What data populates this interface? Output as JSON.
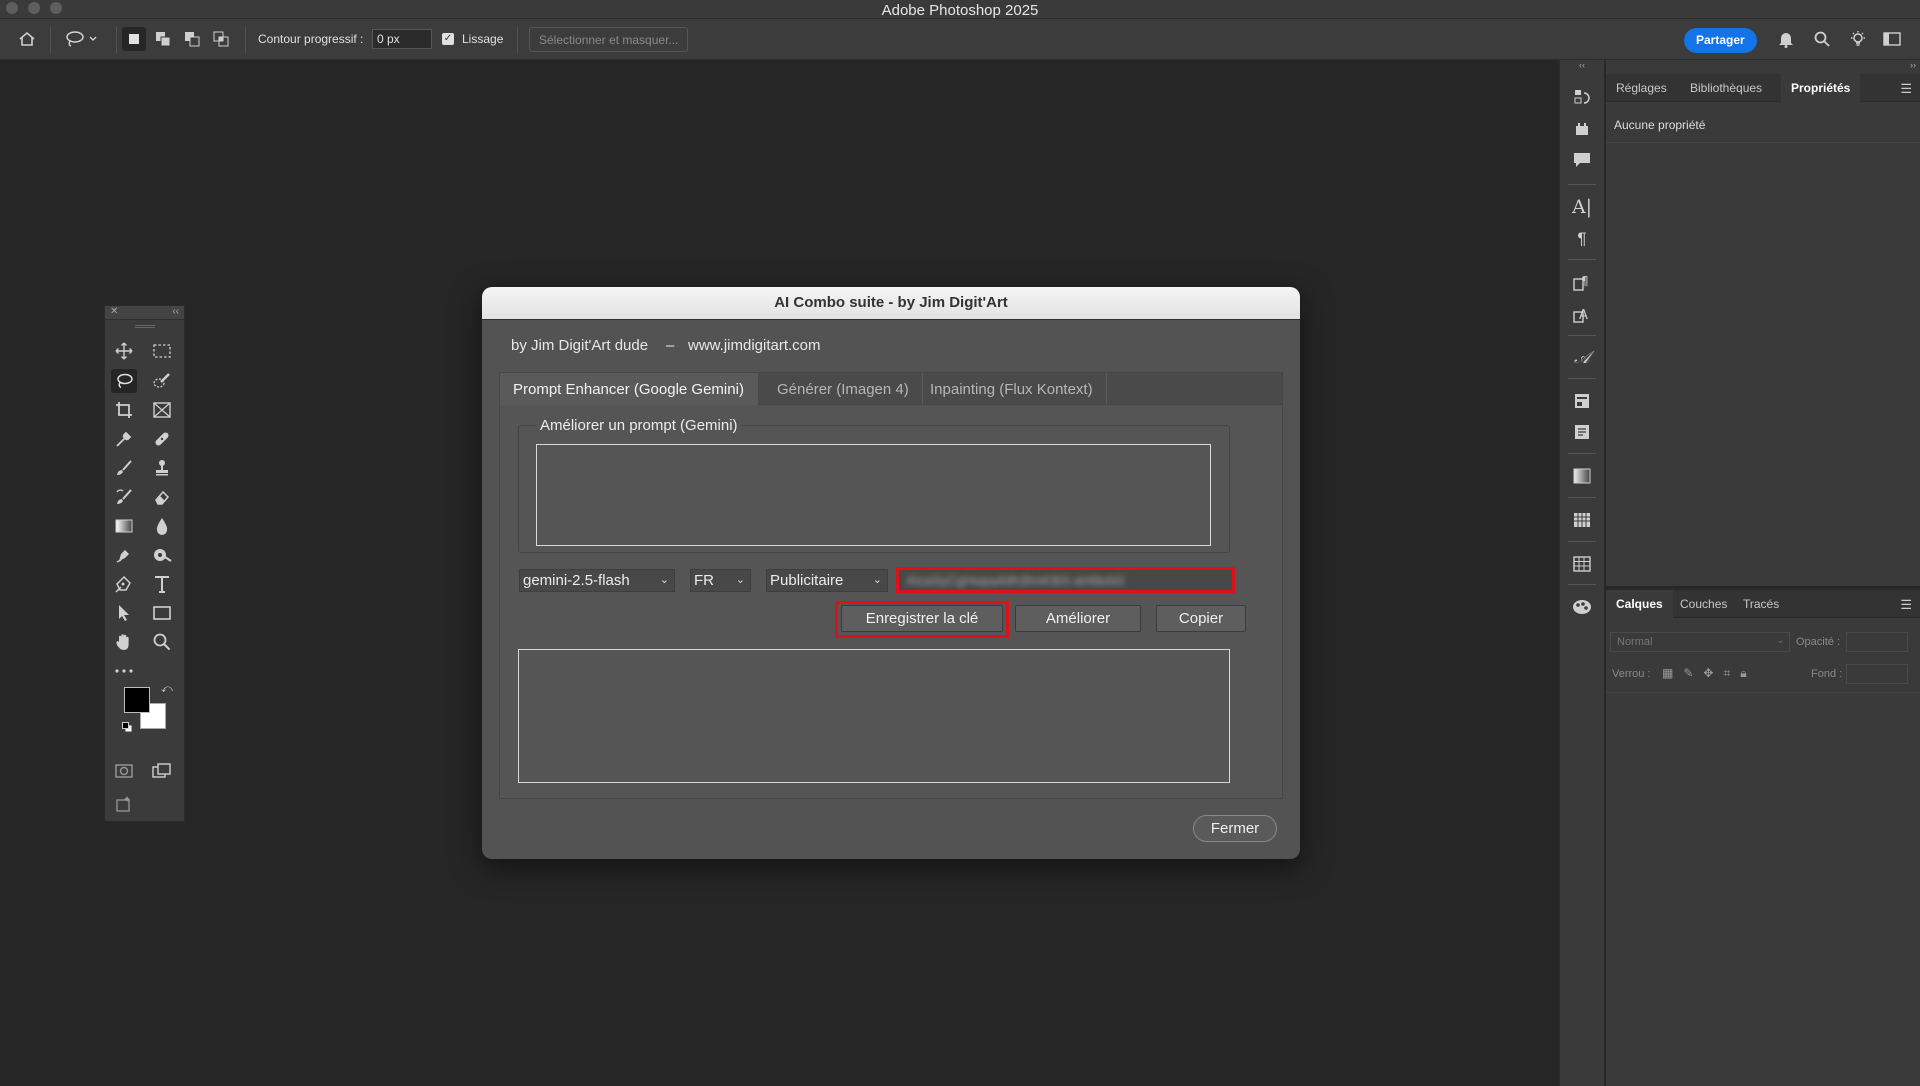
{
  "app": {
    "window_title": "Adobe Photoshop 2025"
  },
  "options_bar": {
    "feather_label": "Contour progressif :",
    "feather_value": "0 px",
    "antialias_label": "Lissage",
    "antialias_checked": true,
    "select_mask_label": "Sélectionner et masquer...",
    "share_label": "Partager"
  },
  "properties_panel": {
    "tabs": [
      "Réglages",
      "Bibliothèques",
      "Propriétés"
    ],
    "active_tab": "Propriétés",
    "empty_text": "Aucune propriété"
  },
  "layers_panel": {
    "tabs": [
      "Calques",
      "Couches",
      "Tracés"
    ],
    "active_tab": "Calques",
    "blend_mode": "Normal",
    "opacity_label": "Opacité :",
    "lock_label": "Verrou :",
    "fill_label": "Fond :"
  },
  "dialog": {
    "title": "AI Combo suite - by Jim Digit'Art",
    "byline": "by Jim Digit'Art dude",
    "separator": "–",
    "website": "www.jimdigitart.com",
    "tabs": [
      "Prompt Enhancer (Google Gemini)",
      "Générer (Imagen 4)",
      "Inpainting (Flux Kontext)"
    ],
    "active_tab": "Prompt Enhancer (Google Gemini)",
    "group_label": "Améliorer un prompt (Gemini)",
    "prompt_input": "",
    "model_select": "gemini-2.5-flash",
    "language_select": "FR",
    "style_select": "Publicitaire",
    "api_key_value": "AIzaSyCgHwpaA9h3hnK9tX-aH6kAI0",
    "save_key_label": "Enregistrer la clé",
    "improve_label": "Améliorer",
    "copy_label": "Copier",
    "output_text": "",
    "close_label": "Fermer"
  },
  "colors": {
    "highlight": "#e0101a",
    "share_blue": "#1473e6",
    "foreground_swatch": "#000000",
    "background_swatch": "#ffffff"
  },
  "icons": {
    "toolbox": [
      "move-tool",
      "marquee-tool",
      "lasso-tool",
      "quick-select-tool",
      "crop-tool",
      "frame-tool",
      "eyedropper-tool",
      "healing-tool",
      "brush-tool",
      "stamp-tool",
      "history-brush-tool",
      "eraser-tool",
      "gradient-tool",
      "blur-tool",
      "dodge-tool",
      "smudge-tool",
      "pen-tool",
      "type-tool",
      "path-select-tool",
      "rectangle-tool",
      "hand-tool",
      "zoom-tool",
      "more-tools"
    ]
  }
}
